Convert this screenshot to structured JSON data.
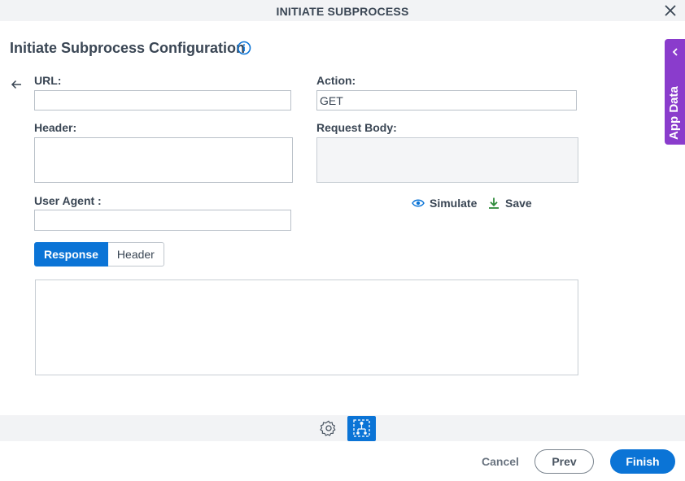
{
  "window": {
    "title": "INITIATE SUBPROCESS"
  },
  "page": {
    "heading": "Initiate Subprocess Configuration"
  },
  "form": {
    "url_label": "URL:",
    "url_value": "",
    "action_label": "Action:",
    "action_value": "GET",
    "header_label": "Header:",
    "header_value": "",
    "request_body_label": "Request Body:",
    "request_body_value": "",
    "user_agent_label": "User Agent :",
    "user_agent_value": ""
  },
  "actions": {
    "simulate_label": "Simulate",
    "save_label": "Save"
  },
  "tabs": [
    {
      "label": "Response",
      "active": true
    },
    {
      "label": "Header",
      "active": false
    }
  ],
  "response": {
    "value": ""
  },
  "side_panel": {
    "label": "App Data"
  },
  "footer": {
    "cancel_label": "Cancel",
    "prev_label": "Prev",
    "finish_label": "Finish"
  },
  "colors": {
    "primary": "#0b74d6",
    "side_panel": "#8a3ccc",
    "save_icon": "#2e8b3a"
  },
  "icons": {
    "close": "close-icon",
    "info": "info-icon",
    "back": "arrow-left-icon",
    "simulate": "eye-icon",
    "save": "download-icon",
    "side_chevron": "chevron-left-icon",
    "settings": "gear-icon",
    "flow": "flow-diagram-icon"
  }
}
